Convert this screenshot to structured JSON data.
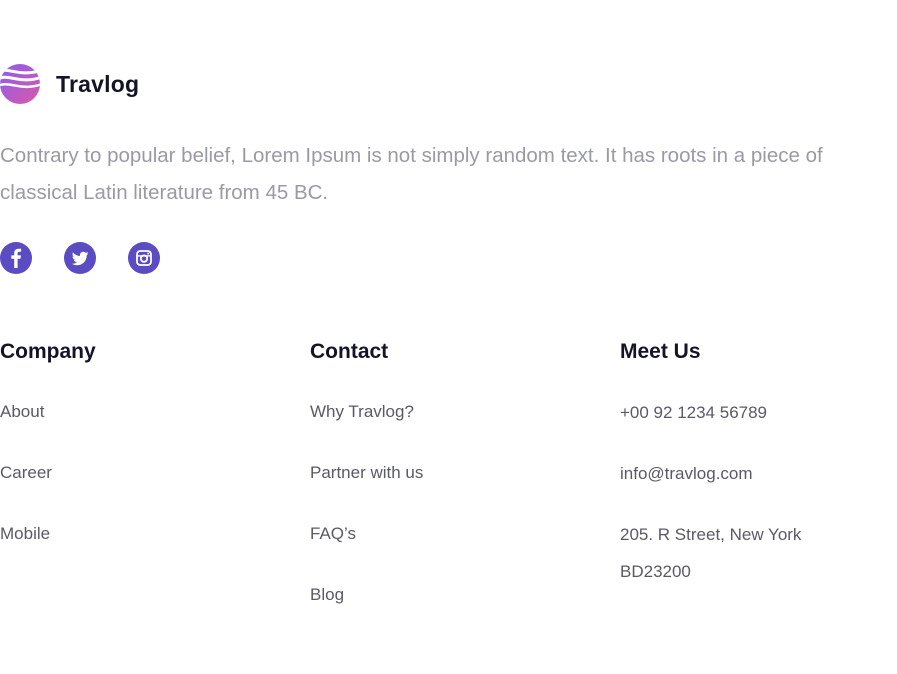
{
  "brand": {
    "name": "Travlog",
    "logo_icon": "wave-globe-logo-icon",
    "logo_colors": [
      "#8c5cf0",
      "#d95aa8"
    ]
  },
  "tagline": "Contrary to popular belief, Lorem Ipsum is not simply random text. It has roots in a piece of classical Latin literature from 45 BC.",
  "socials": [
    {
      "name": "facebook",
      "icon": "facebook-icon"
    },
    {
      "name": "twitter",
      "icon": "twitter-icon"
    },
    {
      "name": "instagram",
      "icon": "instagram-icon"
    }
  ],
  "accent_color": "#5b4cc4",
  "columns": {
    "company": {
      "title": "Company",
      "items": [
        "About",
        "Career",
        "Mobile"
      ]
    },
    "contact": {
      "title": "Contact",
      "items": [
        "Why Travlog?",
        "Partner with us",
        "FAQ’s",
        "Blog"
      ]
    },
    "meet": {
      "title": "Meet Us",
      "items": [
        "+00 92 1234 56789",
        "info@travlog.com",
        "205. R Street, New York BD23200"
      ]
    }
  }
}
